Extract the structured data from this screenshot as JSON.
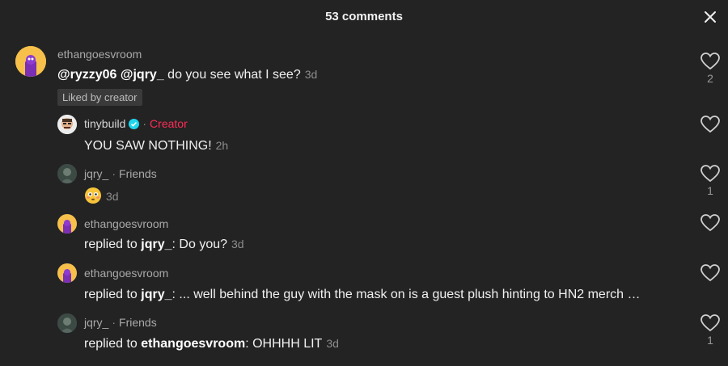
{
  "header": {
    "title": "53 comments"
  },
  "comments": [
    {
      "username": "ethangoesvroom",
      "mention1": "@ryzzy06",
      "mention2": "@jqry_",
      "text": "do you see what I see?",
      "time": "3d",
      "badge": "Liked by creator",
      "likes": "2"
    },
    {
      "username": "tinybuild",
      "label": "Creator",
      "text": "YOU SAW NOTHING!",
      "time": "2h"
    },
    {
      "username": "jqry_",
      "label": "Friends",
      "emoji": "flushed-face-emoji",
      "time": "3d",
      "likes": "1"
    },
    {
      "username": "ethangoesvroom",
      "prefix": "replied to",
      "reply_to": "jqry_",
      "text": ": Do you?",
      "time": "3d"
    },
    {
      "username": "ethangoesvroom",
      "prefix": "replied to",
      "reply_to": "jqry_",
      "text": ": ... well behind the guy with the mask on is a guest plush hinting to HN2 merch …"
    },
    {
      "username": "jqry_",
      "label": "Friends",
      "prefix": "replied to",
      "reply_to": "ethangoesvroom",
      "text": ": OHHHH LIT",
      "time": "3d",
      "likes": "1"
    }
  ],
  "colors": {
    "background": "#232323",
    "creator": "#fe2c55",
    "verified": "#20d5ec"
  },
  "icons": {
    "close": "close-icon",
    "like": "heart-icon",
    "verified": "verified-badge-icon"
  }
}
